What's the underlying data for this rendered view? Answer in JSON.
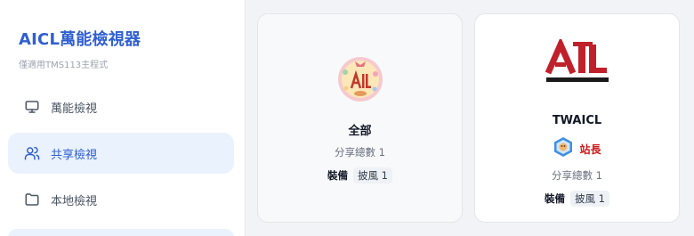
{
  "sidebar": {
    "title": "AICL萬能檢視器",
    "subtitle": "僅適用TMS113主程式",
    "items": [
      {
        "label": "萬能檢視",
        "icon": "monitor-icon"
      },
      {
        "label": "共享檢視",
        "icon": "users-icon"
      },
      {
        "label": "本地檢視",
        "icon": "folder-icon"
      }
    ]
  },
  "cards": [
    {
      "name": "全部",
      "share_count": "分享總數 1",
      "equip_label": "裝備",
      "equip_tag": "披風 1"
    },
    {
      "name": "TWAICL",
      "role": "站長",
      "share_count": "分享總數 1",
      "equip_label": "裝備",
      "equip_tag": "披風 1"
    }
  ],
  "colors": {
    "accent": "#2f5fd0",
    "active_bg": "#eaf2fd",
    "role_red": "#d11a1a"
  }
}
